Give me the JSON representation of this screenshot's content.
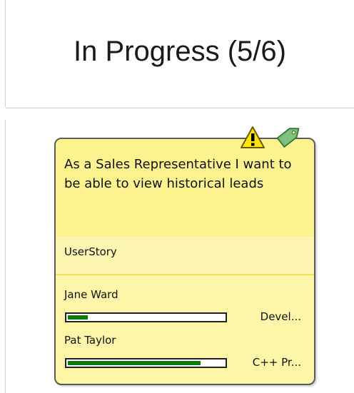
{
  "column": {
    "title": "In Progress (5/6)"
  },
  "card": {
    "title": "As a Sales Representative I want to be able to view historical leads",
    "type": "UserStory",
    "icons": [
      "warning-icon",
      "tag-icon"
    ],
    "assignees": [
      {
        "name": "Jane Ward",
        "role": "Devel...",
        "progress": 0.13
      },
      {
        "name": "Pat Taylor",
        "role": "C++ Pr...",
        "progress": 0.85
      }
    ]
  },
  "colors": {
    "card_title_bg": "#fcf38f",
    "card_body_bg": "#fdf5a8",
    "progress_fill": "#0b7a0b",
    "warning_yellow": "#ffe600",
    "tag_green": "#6cb26c"
  }
}
